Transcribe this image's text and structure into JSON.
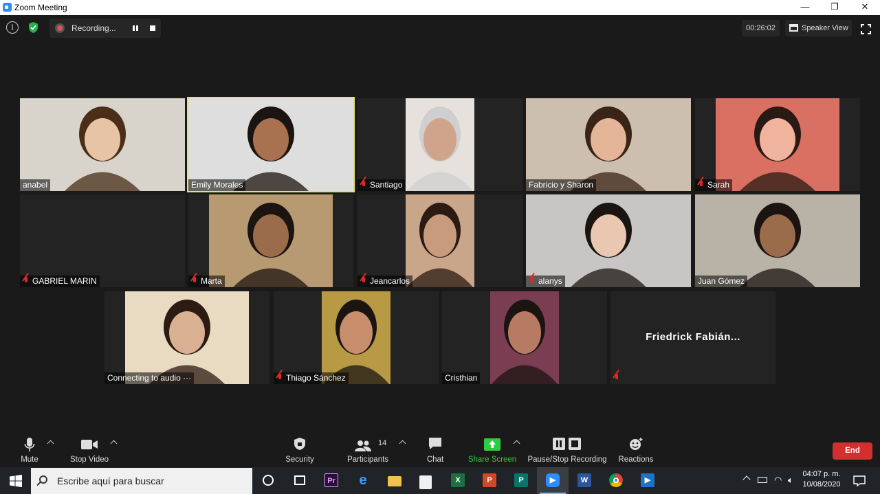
{
  "window": {
    "title": "Zoom Meeting",
    "minimize": "—",
    "restore": "❐",
    "close": "✕"
  },
  "topbar": {
    "recording_label": "Recording...",
    "timer": "00:26:02",
    "view_label": "Speaker View"
  },
  "participants": [
    {
      "name": "anabel",
      "muted": false,
      "bg": "#d8d4cc",
      "skin": "#e8c4a6",
      "hair": "#4a2e18"
    },
    {
      "name": "Emily Morales",
      "muted": false,
      "active": true,
      "bg": "#dedede",
      "skin": "#a8714f",
      "hair": "#1c1410"
    },
    {
      "name": "Santiago",
      "muted": true,
      "bg": "#e6e1dc",
      "skin": "#cfa48a",
      "hair": "#cfcfcf"
    },
    {
      "name": "Fabricio y Sharon",
      "muted": false,
      "bg": "#cdbfb0",
      "skin": "#e4b596",
      "hair": "#3a2418"
    },
    {
      "name": "Sarah",
      "muted": true,
      "bg": "#d97062",
      "skin": "#f0b39d",
      "hair": "#2a1a14"
    },
    {
      "name": "GABRIEL MARIN",
      "muted": true,
      "bg": "#232323"
    },
    {
      "name": "Marta",
      "muted": true,
      "bg": "#b79a72",
      "skin": "#9b6c4c",
      "hair": "#1c1410"
    },
    {
      "name": "Jeancarlos",
      "muted": true,
      "bg": "#c9a58a",
      "skin": "#c99b7e",
      "hair": "#2b1b12"
    },
    {
      "name": "alanys",
      "muted": true,
      "bg": "#c7c6c4",
      "skin": "#e9c7b0",
      "hair": "#1b1512"
    },
    {
      "name": "Juan Gómez",
      "muted": false,
      "bg": "#b8b3a6",
      "skin": "#9b6c4c",
      "hair": "#1c1410"
    },
    {
      "name": "Connecting to audio ···",
      "muted": false,
      "bg": "#e9dac2",
      "skin": "#d9b091",
      "hair": "#2b1b12"
    },
    {
      "name": "Thiago Sánchez",
      "muted": true,
      "bg": "#b89a45",
      "skin": "#c88d6a",
      "hair": "#1b1512"
    },
    {
      "name": "Cristhian",
      "muted": false,
      "bg": "#7b3d52",
      "skin": "#b77b63",
      "hair": "#1b1512"
    },
    {
      "name": "Friedrick Fabián...",
      "muted": true,
      "bg": "#232323",
      "name_only": true
    }
  ],
  "toolbar": {
    "mute": "Mute",
    "stop_video": "Stop Video",
    "security": "Security",
    "participants": "Participants",
    "participants_count": "14",
    "chat": "Chat",
    "share_screen": "Share Screen",
    "pause_stop_recording": "Pause/Stop Recording",
    "reactions": "Reactions",
    "end": "End"
  },
  "taskbar": {
    "search_placeholder": "Escribe aquí para buscar",
    "time": "04:07 p. m.",
    "date": "10/08/2020"
  },
  "colors": {
    "accent_green": "#2ecc40",
    "end_red": "#d32f2f",
    "active_speaker": "#e3e36b",
    "zoom_blue": "#2d8cff"
  }
}
